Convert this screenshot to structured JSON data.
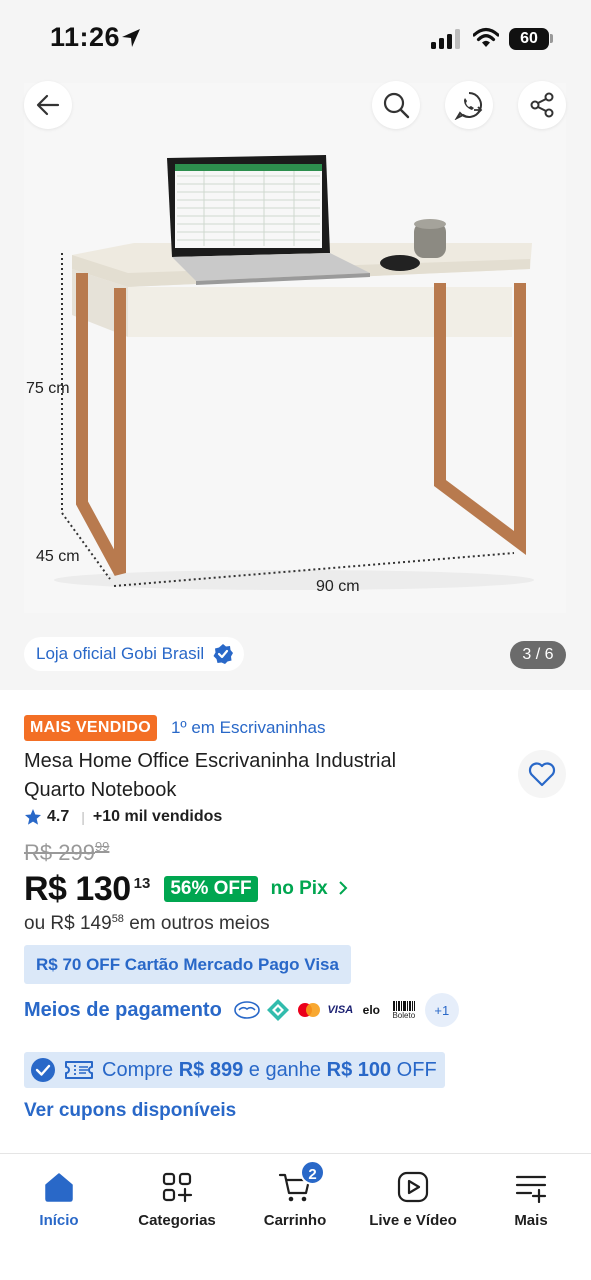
{
  "status_bar": {
    "time": "11:26",
    "battery": "60"
  },
  "gallery": {
    "store_name": "Loja oficial Gobi Brasil",
    "counter": "3 / 6",
    "dimensions": {
      "height": "75 cm",
      "depth": "45 cm",
      "width": "90 cm"
    }
  },
  "product": {
    "best_seller_badge": "MAIS VENDIDO",
    "ranking": "1º em Escrivaninhas",
    "title": "Mesa Home Office Escrivaninha Industrial Quarto Notebook",
    "rating": "4.7",
    "sold": "+10 mil vendidos",
    "old_price": "R$ 299",
    "old_price_cents": "99",
    "price": "R$ 130",
    "price_cents": "13",
    "discount": "56% OFF",
    "pix_label": "no Pix",
    "alt_price_prefix": "ou R$ 149",
    "alt_price_cents": "58",
    "alt_price_suffix": " em outros meios",
    "card_promo": "R$ 70 OFF Cartão Mercado Pago Visa",
    "payment_label": "Meios de pagamento",
    "payment_more": "+1",
    "payment_icons": [
      "mercado-pago-icon",
      "pix-icon",
      "mastercard-icon",
      "visa-icon",
      "elo-icon",
      "boleto-icon"
    ],
    "payment_texts": {
      "visa": "VISA",
      "elo": "elo",
      "boleto": "Boleto"
    },
    "coupon": {
      "prefix": "Compre ",
      "amount": "R$ 899",
      "middle": " e ganhe ",
      "reward": "R$ 100",
      "suffix": " OFF"
    },
    "coupons_link": "Ver cupons disponíveis"
  },
  "bottom_nav": {
    "items": [
      {
        "label": "Início",
        "icon": "home-icon",
        "active": true
      },
      {
        "label": "Categorias",
        "icon": "categories-icon"
      },
      {
        "label": "Carrinho",
        "icon": "cart-icon",
        "badge": "2"
      },
      {
        "label": "Live e Vídeo",
        "icon": "play-icon"
      },
      {
        "label": "Mais",
        "icon": "menu-plus-icon"
      }
    ]
  },
  "colors": {
    "accent_blue": "#2968c8",
    "green": "#00a650",
    "orange": "#f36f25",
    "copper": "#b87a4e"
  }
}
